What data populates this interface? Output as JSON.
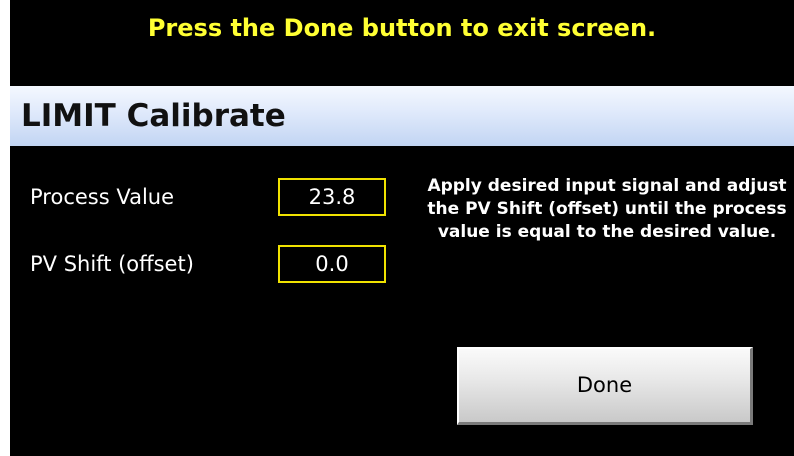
{
  "colors": {
    "background": "#000000",
    "instruction_text": "#ffff33",
    "field_border": "#f0e200",
    "title_bar": "#dfe9fb"
  },
  "instruction": "Press the Done button to exit screen.",
  "title": "LIMIT Calibrate",
  "fields": [
    {
      "label": "Process Value",
      "value": "23.8"
    },
    {
      "label": "PV Shift (offset)",
      "value": "0.0"
    }
  ],
  "help_text": "Apply desired input signal and adjust the PV Shift (offset) until the process value is equal to the desired value.",
  "done_button": {
    "label": "Done"
  }
}
